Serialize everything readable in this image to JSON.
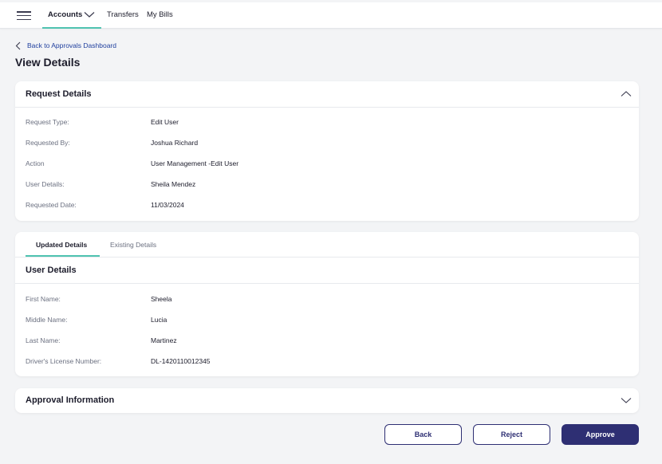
{
  "nav": {
    "items": [
      {
        "label": "Accounts"
      },
      {
        "label": "Transfers"
      },
      {
        "label": "My Bills"
      }
    ]
  },
  "back_link": "Back to Approvals Dashboard",
  "page_title": "View Details",
  "request_details": {
    "title": "Request Details",
    "rows": [
      {
        "label": "Request Type:",
        "value": "Edit User"
      },
      {
        "label": "Requested By:",
        "value": "Joshua Richard"
      },
      {
        "label": "Action",
        "value": "User Management -Edit User"
      },
      {
        "label": "User Details:",
        "value": "Sheila Mendez"
      },
      {
        "label": "Requested Date:",
        "value": "11/03/2024"
      }
    ]
  },
  "updated_panel": {
    "tabs": [
      {
        "label": "Updated Details"
      },
      {
        "label": "Existing Details"
      }
    ],
    "section_title": "User Details",
    "rows": [
      {
        "label": "First Name:",
        "value": "Sheela"
      },
      {
        "label": "Middle Name:",
        "value": "Lucia"
      },
      {
        "label": "Last Name:",
        "value": "Martinez"
      },
      {
        "label": "Driver's License Number:",
        "value": "DL-1420110012345"
      }
    ]
  },
  "approval_information": {
    "title": "Approval Information"
  },
  "actions": {
    "back": "Back",
    "reject": "Reject",
    "approve": "Approve"
  },
  "colors": {
    "accent": "#4fc3b0",
    "primary": "#2e2f73",
    "link": "#1f3f9e",
    "background": "#f3f4f6"
  },
  "icons": [
    "hamburger-menu-icon",
    "chevron-down-icon",
    "chevron-left-icon",
    "chevron-up-icon"
  ]
}
